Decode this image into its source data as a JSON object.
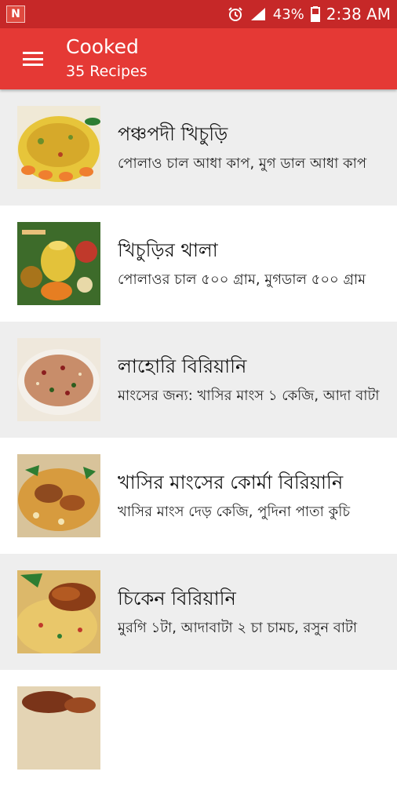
{
  "status": {
    "notification_letter": "N",
    "battery_pct": "43%",
    "time": "2:38 AM"
  },
  "appbar": {
    "title": "Cooked",
    "subtitle": "35 Recipes"
  },
  "recipes": [
    {
      "title": "পঞ্চপদী খিচুড়ি",
      "desc": "পোলাও চাল আধা কাপ, মুগ ডাল আধা কাপ"
    },
    {
      "title": "খিচুড়ির থালা",
      "desc": "পোলাওর চাল ৫০০ গ্রাম, মুগডাল ৫০০ গ্রাম"
    },
    {
      "title": "লাহোরি বিরিয়ানি",
      "desc": "মাংসের জন্য: খাসির মাংস ১ কেজি, আদা বাটা"
    },
    {
      "title": "খাসির মাংসের কোর্মা বিরিয়ানি",
      "desc": "খাসির মাংস দেড় কেজি, পুদিনা পাতা কুচি"
    },
    {
      "title": "চিকেন বিরিয়ানি",
      "desc": "মুরগি ১টা, আদাবাটা ২ চা চামচ, রসুন বাটা"
    },
    {
      "title": "",
      "desc": ""
    }
  ],
  "colors": {
    "status_bar": "#c62828",
    "app_bar": "#e53935",
    "row_alt": "#eeeeee"
  },
  "icons": [
    "menu-icon",
    "alarm-icon",
    "signal-icon",
    "battery-icon"
  ]
}
